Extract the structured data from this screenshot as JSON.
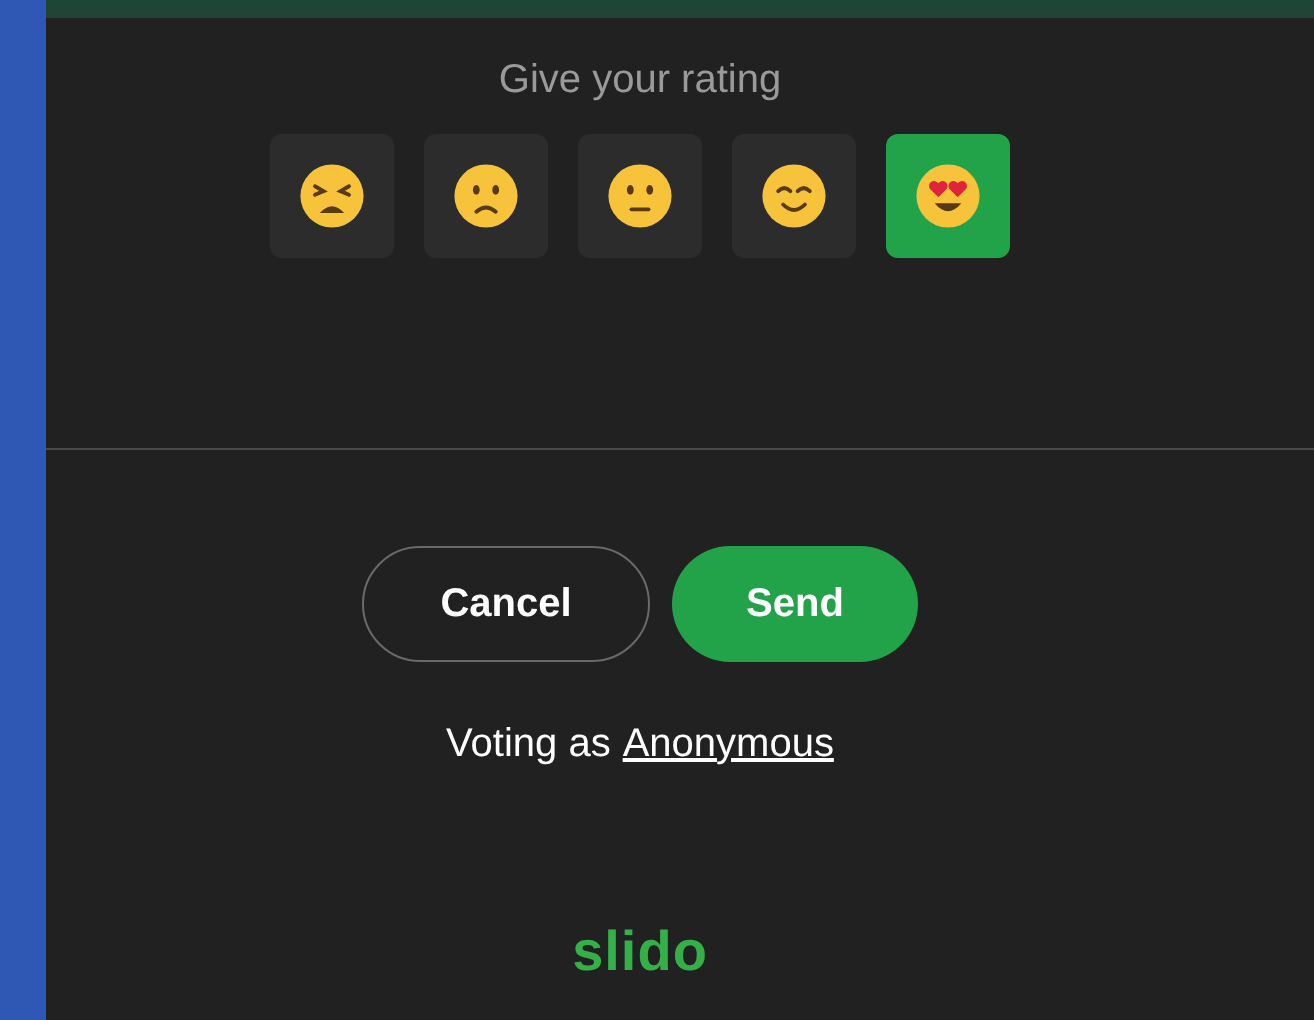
{
  "prompt": "Give your rating",
  "rating_options": [
    {
      "kind": "weary",
      "selected": false
    },
    {
      "kind": "frowning",
      "selected": false
    },
    {
      "kind": "neutral",
      "selected": false
    },
    {
      "kind": "smiling",
      "selected": false
    },
    {
      "kind": "heart_eyes",
      "selected": true
    }
  ],
  "buttons": [
    {
      "kind": "secondary",
      "label": "Cancel"
    },
    {
      "kind": "primary",
      "label": "Send"
    }
  ],
  "voting_as": {
    "prefix": "Voting as",
    "name": "Anonymous"
  },
  "logo": "slido"
}
